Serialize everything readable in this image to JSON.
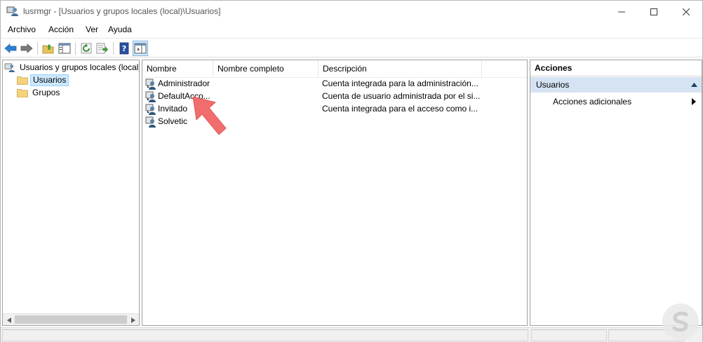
{
  "window": {
    "title": "lusrmgr - [Usuarios y grupos locales (local)\\Usuarios]",
    "minimize_glyph": "—",
    "maximize_glyph": "☐",
    "close_glyph": "✕"
  },
  "menu": {
    "items": [
      "Archivo",
      "Acción",
      "Ver",
      "Ayuda"
    ]
  },
  "toolbar": {
    "buttons": [
      "back-icon",
      "forward-icon",
      "up-folder-icon",
      "show-hide-tree-icon",
      "refresh-icon",
      "export-list-icon",
      "help-icon",
      "show-hide-action-pane-icon"
    ]
  },
  "tree": {
    "root": "Usuarios y grupos locales (local)",
    "children": [
      {
        "label": "Usuarios",
        "selected": true
      },
      {
        "label": "Grupos",
        "selected": false
      }
    ]
  },
  "list": {
    "columns": [
      "Nombre",
      "Nombre completo",
      "Descripción"
    ],
    "rows": [
      {
        "name": "Administrador",
        "full_name": "",
        "description": "Cuenta integrada para la administración..."
      },
      {
        "name": "DefaultAcco...",
        "full_name": "",
        "description": "Cuenta de usuario administrada por el si..."
      },
      {
        "name": "Invitado",
        "full_name": "",
        "description": "Cuenta integrada para el acceso como i..."
      },
      {
        "name": "Solvetic",
        "full_name": "",
        "description": ""
      }
    ]
  },
  "actions": {
    "title": "Acciones",
    "section": "Usuarios",
    "item": "Acciones adicionales"
  },
  "colors": {
    "selection_bg": "#cce8ff",
    "section_bg": "#d5e3f3",
    "arrow_annotation": "#f26d6d",
    "folder": "#f5d37c"
  }
}
